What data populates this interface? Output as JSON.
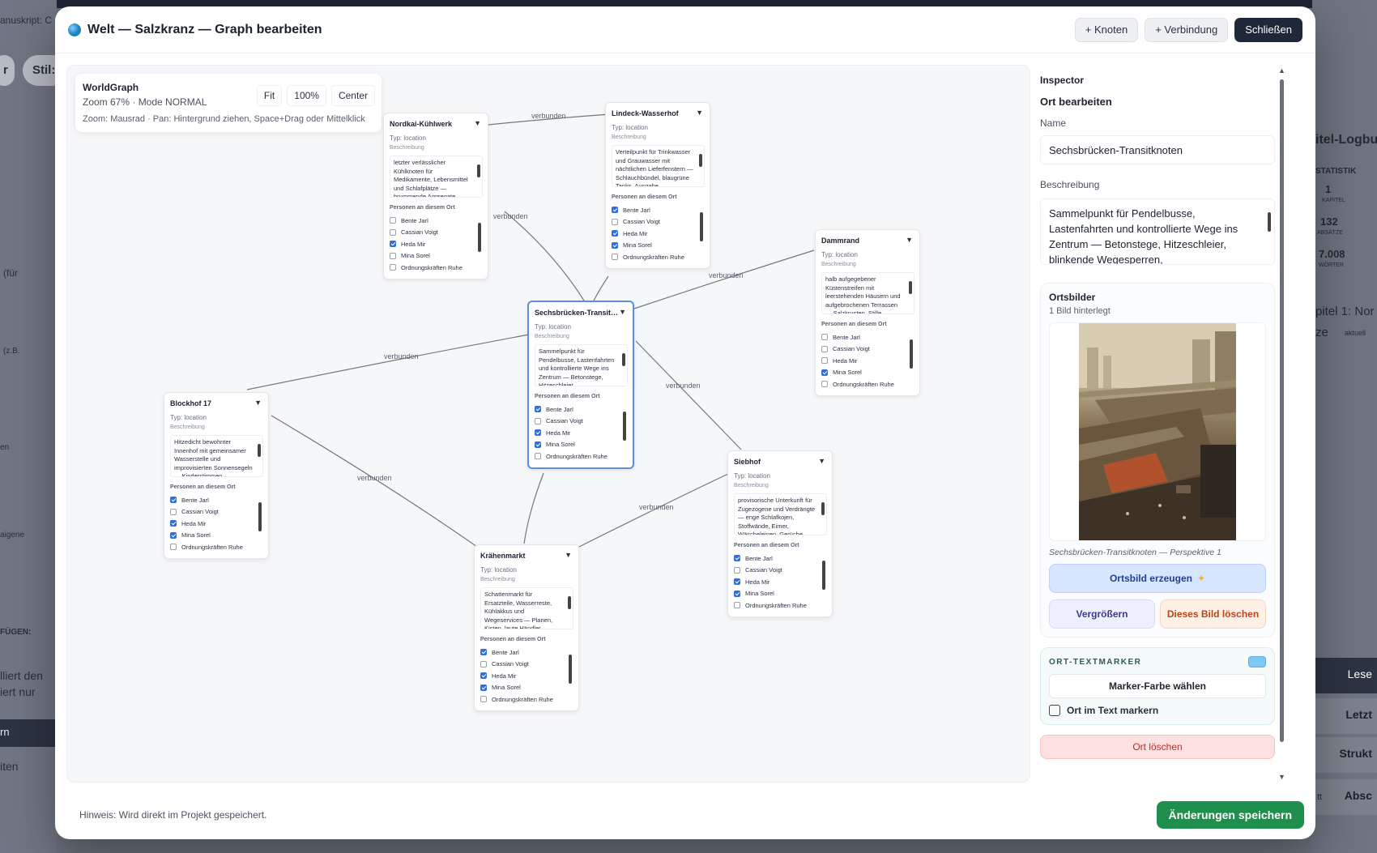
{
  "background": {
    "left_texts": [
      "anuskript: C",
      "(für",
      "(z.B.",
      "en",
      "aigene",
      "FÜGEN:",
      "lliert den",
      "iert nur",
      "rn",
      "iten"
    ],
    "pills": [
      "r",
      "Stil:"
    ],
    "right": {
      "title": "itel-Logbu",
      "stat_label": "STATISTIK",
      "stats": [
        {
          "value": "1",
          "label": "KAPITEL"
        },
        {
          "value": "132",
          "label": "ABSÄTZE"
        },
        {
          "value": "7.008",
          "label": "WÖRTER"
        }
      ],
      "chapter": "pitel 1: Nor",
      "chapter_sub": "ze",
      "chapter_tag": "aktuell",
      "bands": [
        "Lese",
        "Letzt",
        "Strukt",
        "Absc"
      ],
      "tt": "tt"
    }
  },
  "modal": {
    "title": "Welt — Salzkranz — Graph bearbeiten",
    "buttons": {
      "add_node": "+ Knoten",
      "add_edge": "+ Verbindung",
      "close": "Schließen"
    },
    "worldgraph": {
      "title": "WorldGraph",
      "status": "Zoom 67% · Mode NORMAL",
      "help": "Zoom: Mausrad · Pan: Hintergrund ziehen, Space+Drag oder Mittelklick",
      "fit": "Fit",
      "zoom": "100%",
      "center": "Center"
    },
    "edge_label": "verbunden",
    "node_common": {
      "type": "Typ: location",
      "desc_label": "Beschreibung",
      "persons_label": "Personen an diesem Ort"
    },
    "persons": [
      "Bente Jarl",
      "Cassian Voigt",
      "Heda Mir",
      "Mina Sorel",
      "Ordnungskräften Ruhe"
    ],
    "nodes": [
      {
        "id": "nordkai",
        "title": "Nordkai-Kühlwerk",
        "desc": "letzter verlässlicher Kühlknoten für Medikamente, Lebensmittel und Schlafplätze — brummende Aggregate, Kondenswasser",
        "checked": [
          false,
          false,
          true,
          false,
          false
        ]
      },
      {
        "id": "lindeck",
        "title": "Lindeck-Wasserhof",
        "desc": "Verteilpunkt für Trinkwasser und Grauwasser mit nächtlichen Lieferfenstern — Schlauchbündel, blaugrüne Tanks, Ausgabe",
        "checked": [
          true,
          false,
          true,
          true,
          false
        ]
      },
      {
        "id": "dammrand",
        "title": "Dammrand",
        "desc": "halb aufgegebener Küstenstreifen mit leerstehenden Häusern und aufgebrochenen Terrassen — Salzkrusten, Stille",
        "checked": [
          false,
          false,
          false,
          true,
          false
        ]
      },
      {
        "id": "sechs",
        "title": "Sechsbrücken-Transit…",
        "desc": "Sammelpunkt für Pendelbusse, Lastenfahrten und kontrollierte Wege ins Zentrum — Betonstege, Hitzeschleier",
        "checked": [
          true,
          false,
          true,
          true,
          false
        ]
      },
      {
        "id": "blockhof",
        "title": "Blockhof 17",
        "desc": "Hitzedicht bewohnter Innenhof mit gemeinsamer Wasserstelle und improvisierten Sonnensegeln — Kinderstimmen, Ventilatoren",
        "checked": [
          true,
          false,
          true,
          true,
          false
        ]
      },
      {
        "id": "siebhof",
        "title": "Siebhof",
        "desc": "provisorische Unterkunft für Zugezogene und Verdrängte — enge Schlafkojen, Stoffwände, Eimer, Wäscheleinen, Gerüche",
        "checked": [
          true,
          false,
          true,
          true,
          false
        ]
      },
      {
        "id": "kraehen",
        "title": "Krähenmarkt",
        "desc": "Schattenmarkt für Ersatzteile, Wasserreste, Kühlakkus und Wegeservices — Planen, Kisten, laute Händler, Waagen",
        "checked": [
          true,
          false,
          true,
          true,
          false
        ]
      }
    ],
    "inspector": {
      "title": "Inspector",
      "subtitle": "Ort bearbeiten",
      "name_label": "Name",
      "name_value": "Sechsbrücken-Transitknoten",
      "desc_label": "Beschreibung",
      "desc_value": "Sammelpunkt für Pendelbusse, Lastenfahrten und kontrollierte Wege ins Zentrum — Betonstege, Hitzeschleier, blinkende Wegesperren,",
      "images_title": "Ortsbilder",
      "images_count": "1 Bild hinterlegt",
      "caption": "Sechsbrücken-Transitknoten — Perspektive 1",
      "generate": "Ortsbild erzeugen",
      "enlarge": "Vergrößern",
      "delete_image": "Dieses Bild löschen",
      "marker_title": "ORT-TEXTMARKER",
      "marker_color": "#7fc8f2",
      "marker_button": "Marker-Farbe wählen",
      "mark_in_text": "Ort im Text markern",
      "delete_place": "Ort löschen"
    },
    "footer": {
      "hint": "Hinweis: Wird direkt im Projekt gespeichert.",
      "save": "Änderungen speichern"
    }
  }
}
